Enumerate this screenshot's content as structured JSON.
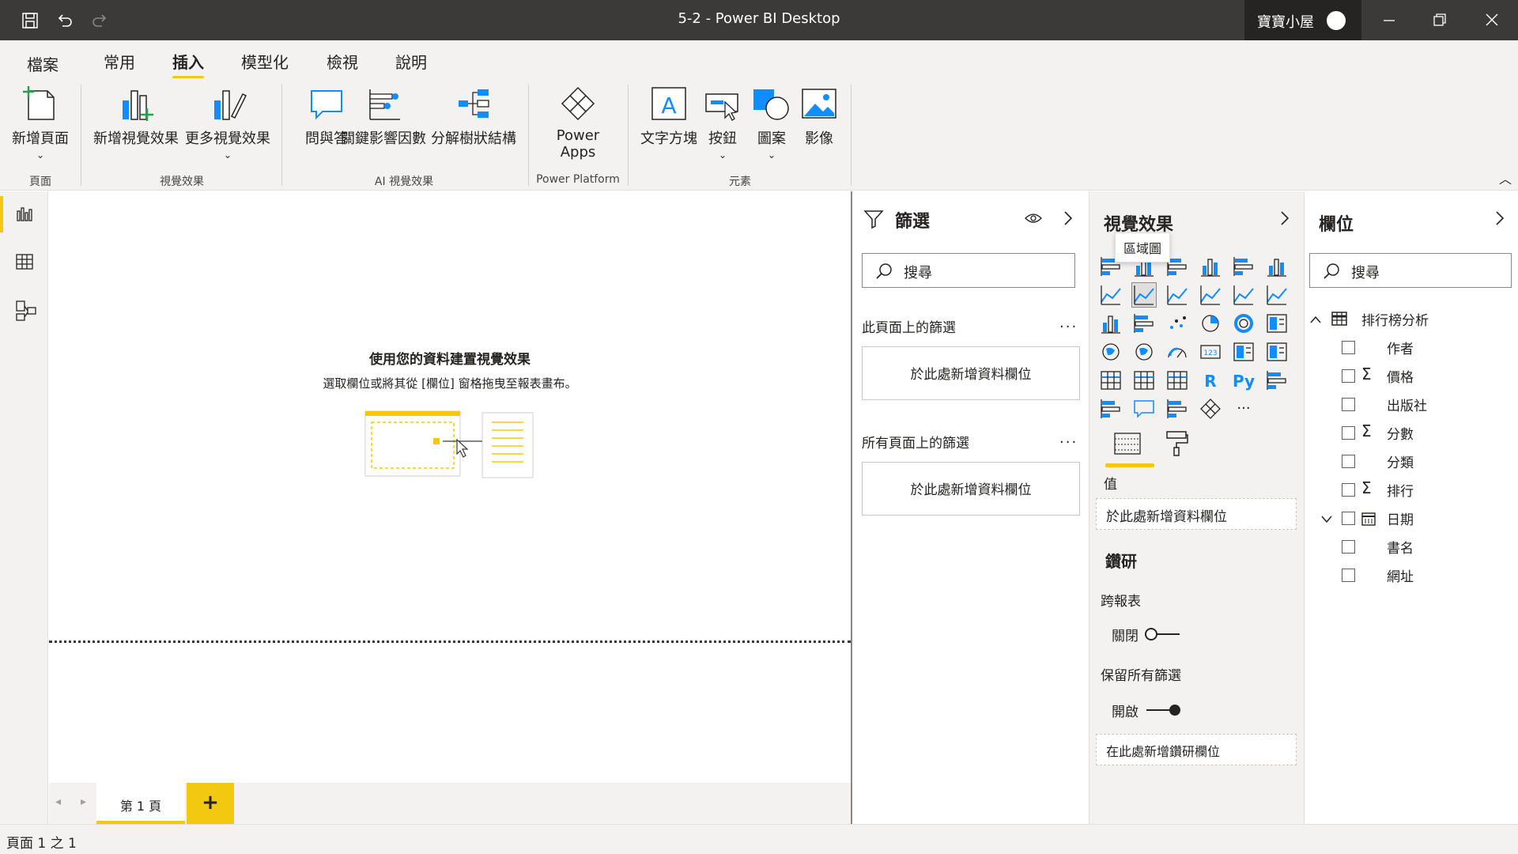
{
  "window": {
    "title": "5-2 - Power BI Desktop",
    "user_name": "寶寶小屋"
  },
  "ribbon_tabs": [
    {
      "label": "檔案"
    },
    {
      "label": "常用"
    },
    {
      "label": "插入"
    },
    {
      "label": "模型化"
    },
    {
      "label": "檢視"
    },
    {
      "label": "說明"
    }
  ],
  "active_tab": "插入",
  "ribbon": {
    "new_page": "新增頁面",
    "new_visual": "新增視覺效果",
    "more_visuals": "更多視覺效果",
    "qa": "問與答",
    "key_influencers": "關鍵影響因數",
    "decomposition_tree": "分解樹狀結構",
    "power_apps_line1": "Power",
    "power_apps_line2": "Apps",
    "text_box": "文字方塊",
    "buttons": "按鈕",
    "shapes": "圖案",
    "image": "影像",
    "groups": {
      "page": "頁面",
      "visuals": "視覺效果",
      "ai_visuals": "AI 視覺效果",
      "power_platform": "Power Platform",
      "elements": "元素"
    }
  },
  "canvas": {
    "placeholder_title": "使用您的資料建置視覺效果",
    "placeholder_subtitle": "選取欄位或將其從 [欄位] 窗格拖曳至報表畫布。"
  },
  "pages": {
    "tabs": [
      {
        "label": "第 1 頁"
      }
    ],
    "add_label": "+"
  },
  "status": {
    "page_indicator": "頁面 1 之 1"
  },
  "filters": {
    "title": "篩選",
    "search_placeholder": "搜尋",
    "this_page_label": "此頁面上的篩選",
    "all_pages_label": "所有頁面上的篩選",
    "add_field": "於此處新增資料欄位",
    "more": "..."
  },
  "visualizations": {
    "title": "視覺效果",
    "tooltip": "區域圖",
    "values_label": "值",
    "add_field": "於此處新增資料欄位",
    "drillthrough_title": "鑽研",
    "cross_report_label": "跨報表",
    "cross_report_state": "關閉",
    "keep_all_filters_label": "保留所有篩選",
    "keep_all_filters_state": "開啟",
    "add_drillthrough": "在此處新增鑽研欄位",
    "more_visuals": "···",
    "icons": [
      "stacked-bar-chart-icon",
      "stacked-column-chart-icon",
      "clustered-bar-chart-icon",
      "clustered-column-chart-icon",
      "100-stacked-bar-chart-icon",
      "100-stacked-column-chart-icon",
      "line-chart-icon",
      "area-chart-icon",
      "stacked-area-chart-icon",
      "line-clustered-column-chart-icon",
      "line-stacked-column-chart-icon",
      "ribbon-chart-icon",
      "waterfall-chart-icon",
      "funnel-chart-icon",
      "scatter-chart-icon",
      "pie-chart-icon",
      "donut-chart-icon",
      "treemap-icon",
      "map-icon",
      "filled-map-icon",
      "gauge-icon",
      "card-icon",
      "multi-row-card-icon",
      "kpi-icon",
      "slicer-icon",
      "table-icon",
      "matrix-icon",
      "r-visual-icon",
      "python-visual-icon",
      "key-influencers-icon",
      "decomposition-tree-icon",
      "qa-visual-icon",
      "smart-narrative-icon",
      "power-apps-icon",
      "more-visuals-icon"
    ]
  },
  "fields": {
    "title": "欄位",
    "search_placeholder": "搜尋",
    "table_name": "排行榜分析",
    "items": [
      {
        "label": "作者",
        "sigma": ""
      },
      {
        "label": "價格",
        "sigma": "Σ"
      },
      {
        "label": "出版社",
        "sigma": ""
      },
      {
        "label": "分數",
        "sigma": "Σ"
      },
      {
        "label": "分類",
        "sigma": ""
      },
      {
        "label": "排行",
        "sigma": "Σ"
      },
      {
        "label": "日期",
        "sigma": ""
      },
      {
        "label": "書名",
        "sigma": ""
      },
      {
        "label": "網址",
        "sigma": ""
      }
    ]
  },
  "colors": {
    "accent": "#f2c811",
    "titlebar": "#3b3a39",
    "icon_blue": "#118dff",
    "pane_bg": "#f3f2f1"
  }
}
